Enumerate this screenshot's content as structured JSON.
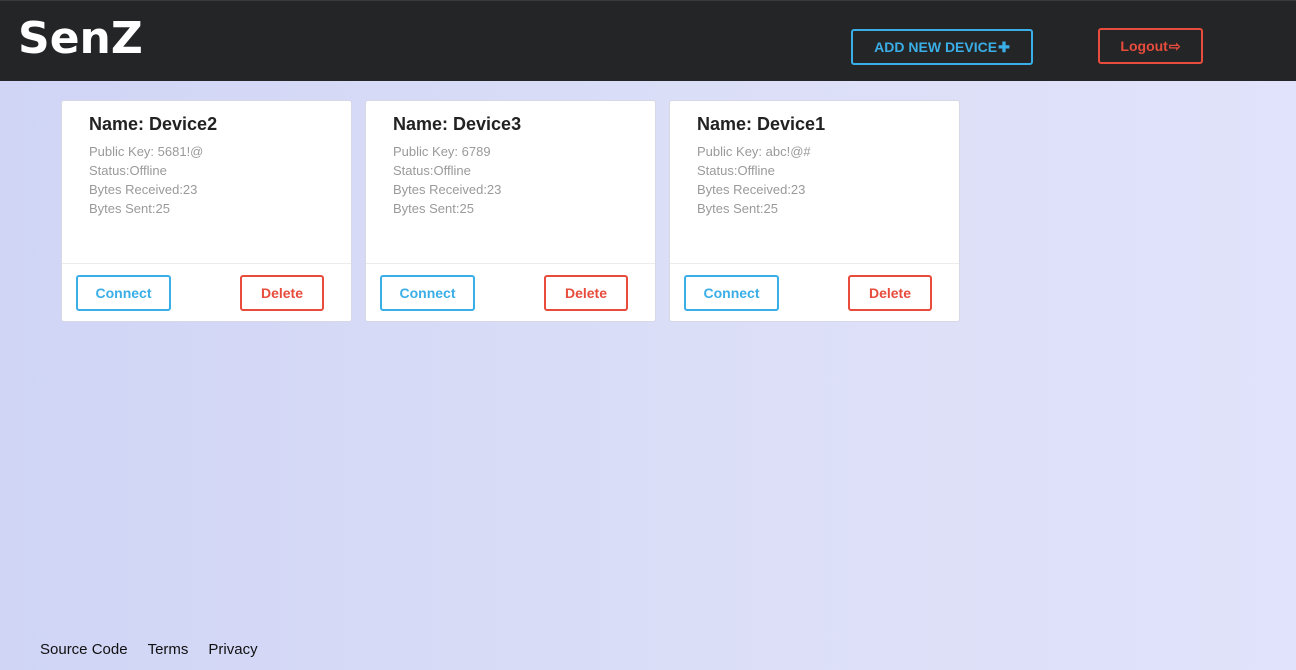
{
  "header": {
    "logo": "SenZ",
    "add_device_label": "ADD NEW DEVICE",
    "add_device_icon": "✚",
    "logout_label": "Logout",
    "logout_icon": "⇨"
  },
  "devices": [
    {
      "name": "Name: Device2",
      "public_key": "Public Key: 5681!@",
      "status": "Status:Offline",
      "bytes_received": "Bytes Received:23",
      "bytes_sent": "Bytes Sent:25",
      "connect_label": "Connect",
      "delete_label": "Delete"
    },
    {
      "name": "Name: Device3",
      "public_key": "Public Key: 6789",
      "status": "Status:Offline",
      "bytes_received": "Bytes Received:23",
      "bytes_sent": "Bytes Sent:25",
      "connect_label": "Connect",
      "delete_label": "Delete"
    },
    {
      "name": "Name: Device1",
      "public_key": "Public Key: abc!@#",
      "status": "Status:Offline",
      "bytes_received": "Bytes Received:23",
      "bytes_sent": "Bytes Sent:25",
      "connect_label": "Connect",
      "delete_label": "Delete"
    }
  ],
  "footer": {
    "links": [
      "Source Code",
      "Terms",
      "Privacy"
    ]
  },
  "colors": {
    "header_bg": "#242527",
    "accent_blue": "#3aaee6",
    "accent_red": "#e74c3c"
  }
}
